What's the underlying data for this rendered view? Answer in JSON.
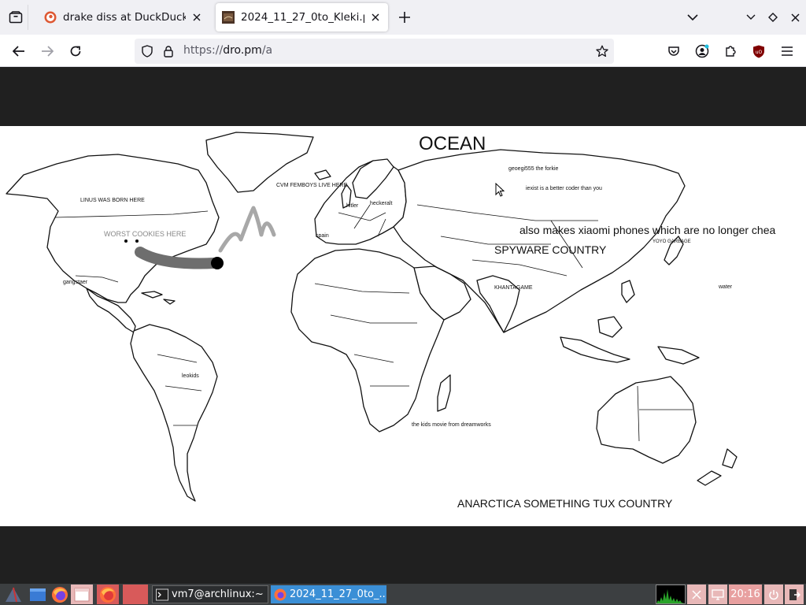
{
  "browser": {
    "tabs": [
      {
        "title": "drake diss at DuckDuckGo",
        "active": false
      },
      {
        "title": "2024_11_27_0to_Kleki.png",
        "active": true
      }
    ],
    "url": {
      "scheme": "https://",
      "host": "dro.pm",
      "path": "/a"
    }
  },
  "map": {
    "labels": {
      "ocean": "OCEAN",
      "linus": "LINUS WAS BORN HERE",
      "worst": "WORST COOKIES HERE",
      "cvm": "CVM FEMBOYS LIVE HERE",
      "hitler": "hitler",
      "heckeralt": "heckeralt",
      "spain": "spain",
      "geoegi": "geoegi555 the forkie",
      "iexist": "iexist is a better coder than you",
      "xiaomi": "also makes xiaomi phones which are no longer chea",
      "spyware": "SPYWARE COUNTRY",
      "yoyo": "YOYO GARBAGE",
      "gangstaer": "gangstaer",
      "khantagame": "KHANTAGAME",
      "water": "water",
      "leokids": "leokids",
      "kidsmovie": "the kids movie from dreamworks",
      "antarctica": "ANARCTICA SOMETHING TUX COUNTRY"
    }
  },
  "taskbar": {
    "tasks": [
      {
        "label": "vm7@archlinux:~"
      },
      {
        "label": "2024_11_27_0to_..."
      }
    ],
    "clock": "20:16"
  },
  "colors": {
    "tabbar": "#f0f0f4",
    "page_bg": "#202020",
    "taskbar": "#3c3f41",
    "active_task": "#3b8fd6"
  }
}
